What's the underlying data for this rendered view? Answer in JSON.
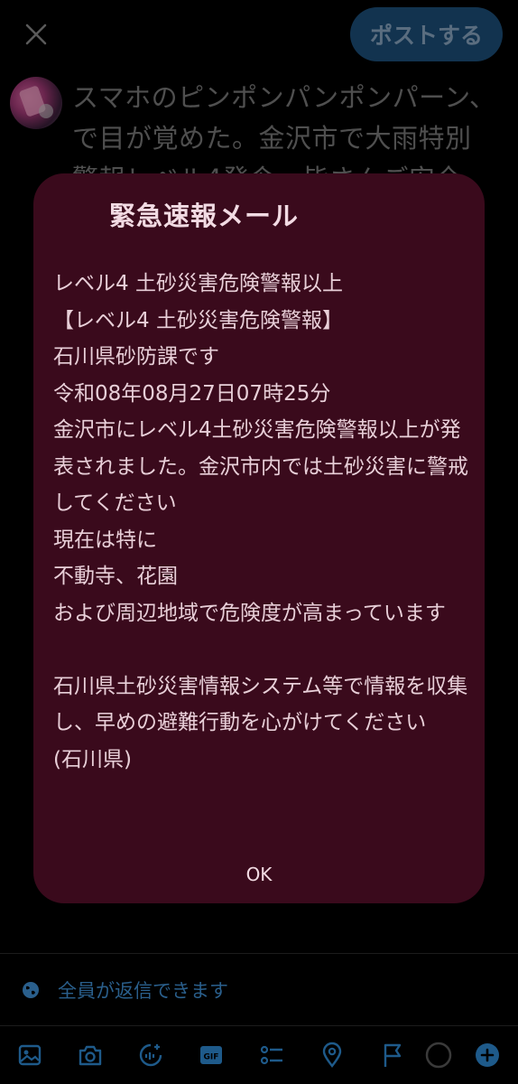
{
  "composer": {
    "post_label": "ポストする",
    "tweet_text": "スマホのピンポンパンポンパーン、で目が覚めた。金沢市で大雨特別警報レベル4発令。皆さんご安全に。"
  },
  "alert": {
    "title": "緊急速報メール",
    "body": "レベル4 土砂災害危険警報以上\n【レベル4 土砂災害危険警報】\n石川県砂防課です\n令和08年08月27日07時25分\n金沢市にレベル4土砂災害危険警報以上が発表されました。金沢市内では土砂災害に警戒してください\n現在は特に\n不動寺、花園\nおよび周辺地域で危険度が高まっています\n\n石川県土砂災害情報システム等で情報を収集し、早めの避難行動を心がけてください\n(石川県)",
    "ok_label": "OK"
  },
  "reply_setting": {
    "label": "全員が返信できます",
    "icon": "globe-icon"
  },
  "toolbar": {
    "icons": [
      "image-icon",
      "camera-icon",
      "grok-icon",
      "gif-icon",
      "poll-icon",
      "location-icon",
      "flag-icon",
      "char-counter-ring",
      "add-post-icon"
    ]
  },
  "colors": {
    "accent": "#1d9bf0",
    "dialog_bg": "#3a0a1c",
    "post_button_bg": "#1d4f7a"
  }
}
